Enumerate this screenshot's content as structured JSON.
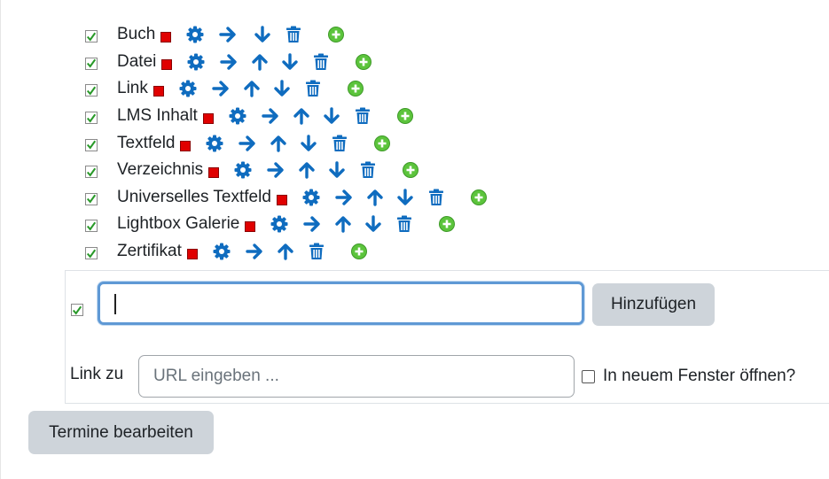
{
  "items": [
    {
      "label": "Buch"
    },
    {
      "label": "Datei"
    },
    {
      "label": "Link"
    },
    {
      "label": "LMS Inhalt"
    },
    {
      "label": "Textfeld"
    },
    {
      "label": "Verzeichnis"
    },
    {
      "label": "Universelles Textfeld"
    },
    {
      "label": "Lightbox Galerie"
    },
    {
      "label": "Zertifikat"
    }
  ],
  "add_form": {
    "name_value": "",
    "add_button_label": "Hinzufügen",
    "link_label": "Link zu",
    "url_placeholder": "URL eingeben ...",
    "new_window_label": "In neuem Fenster öffnen?"
  },
  "edit_button_label": "Termine bearbeiten",
  "colors": {
    "icon_blue": "#0f6cbf",
    "red_square": "#e00000",
    "plus_green": "#5cc43c",
    "checkmark_green": "#2a9a2a",
    "button_gray": "#ced4da",
    "focus_border": "#5f99d5"
  },
  "icons": {
    "checkbox": "checked-checkbox-icon",
    "marker": "red-square-icon",
    "settings": "gear-icon",
    "move_right": "arrow-right-icon",
    "move_up": "arrow-up-icon",
    "move_down": "arrow-down-icon",
    "delete": "trash-icon",
    "add": "plus-circle-icon"
  }
}
